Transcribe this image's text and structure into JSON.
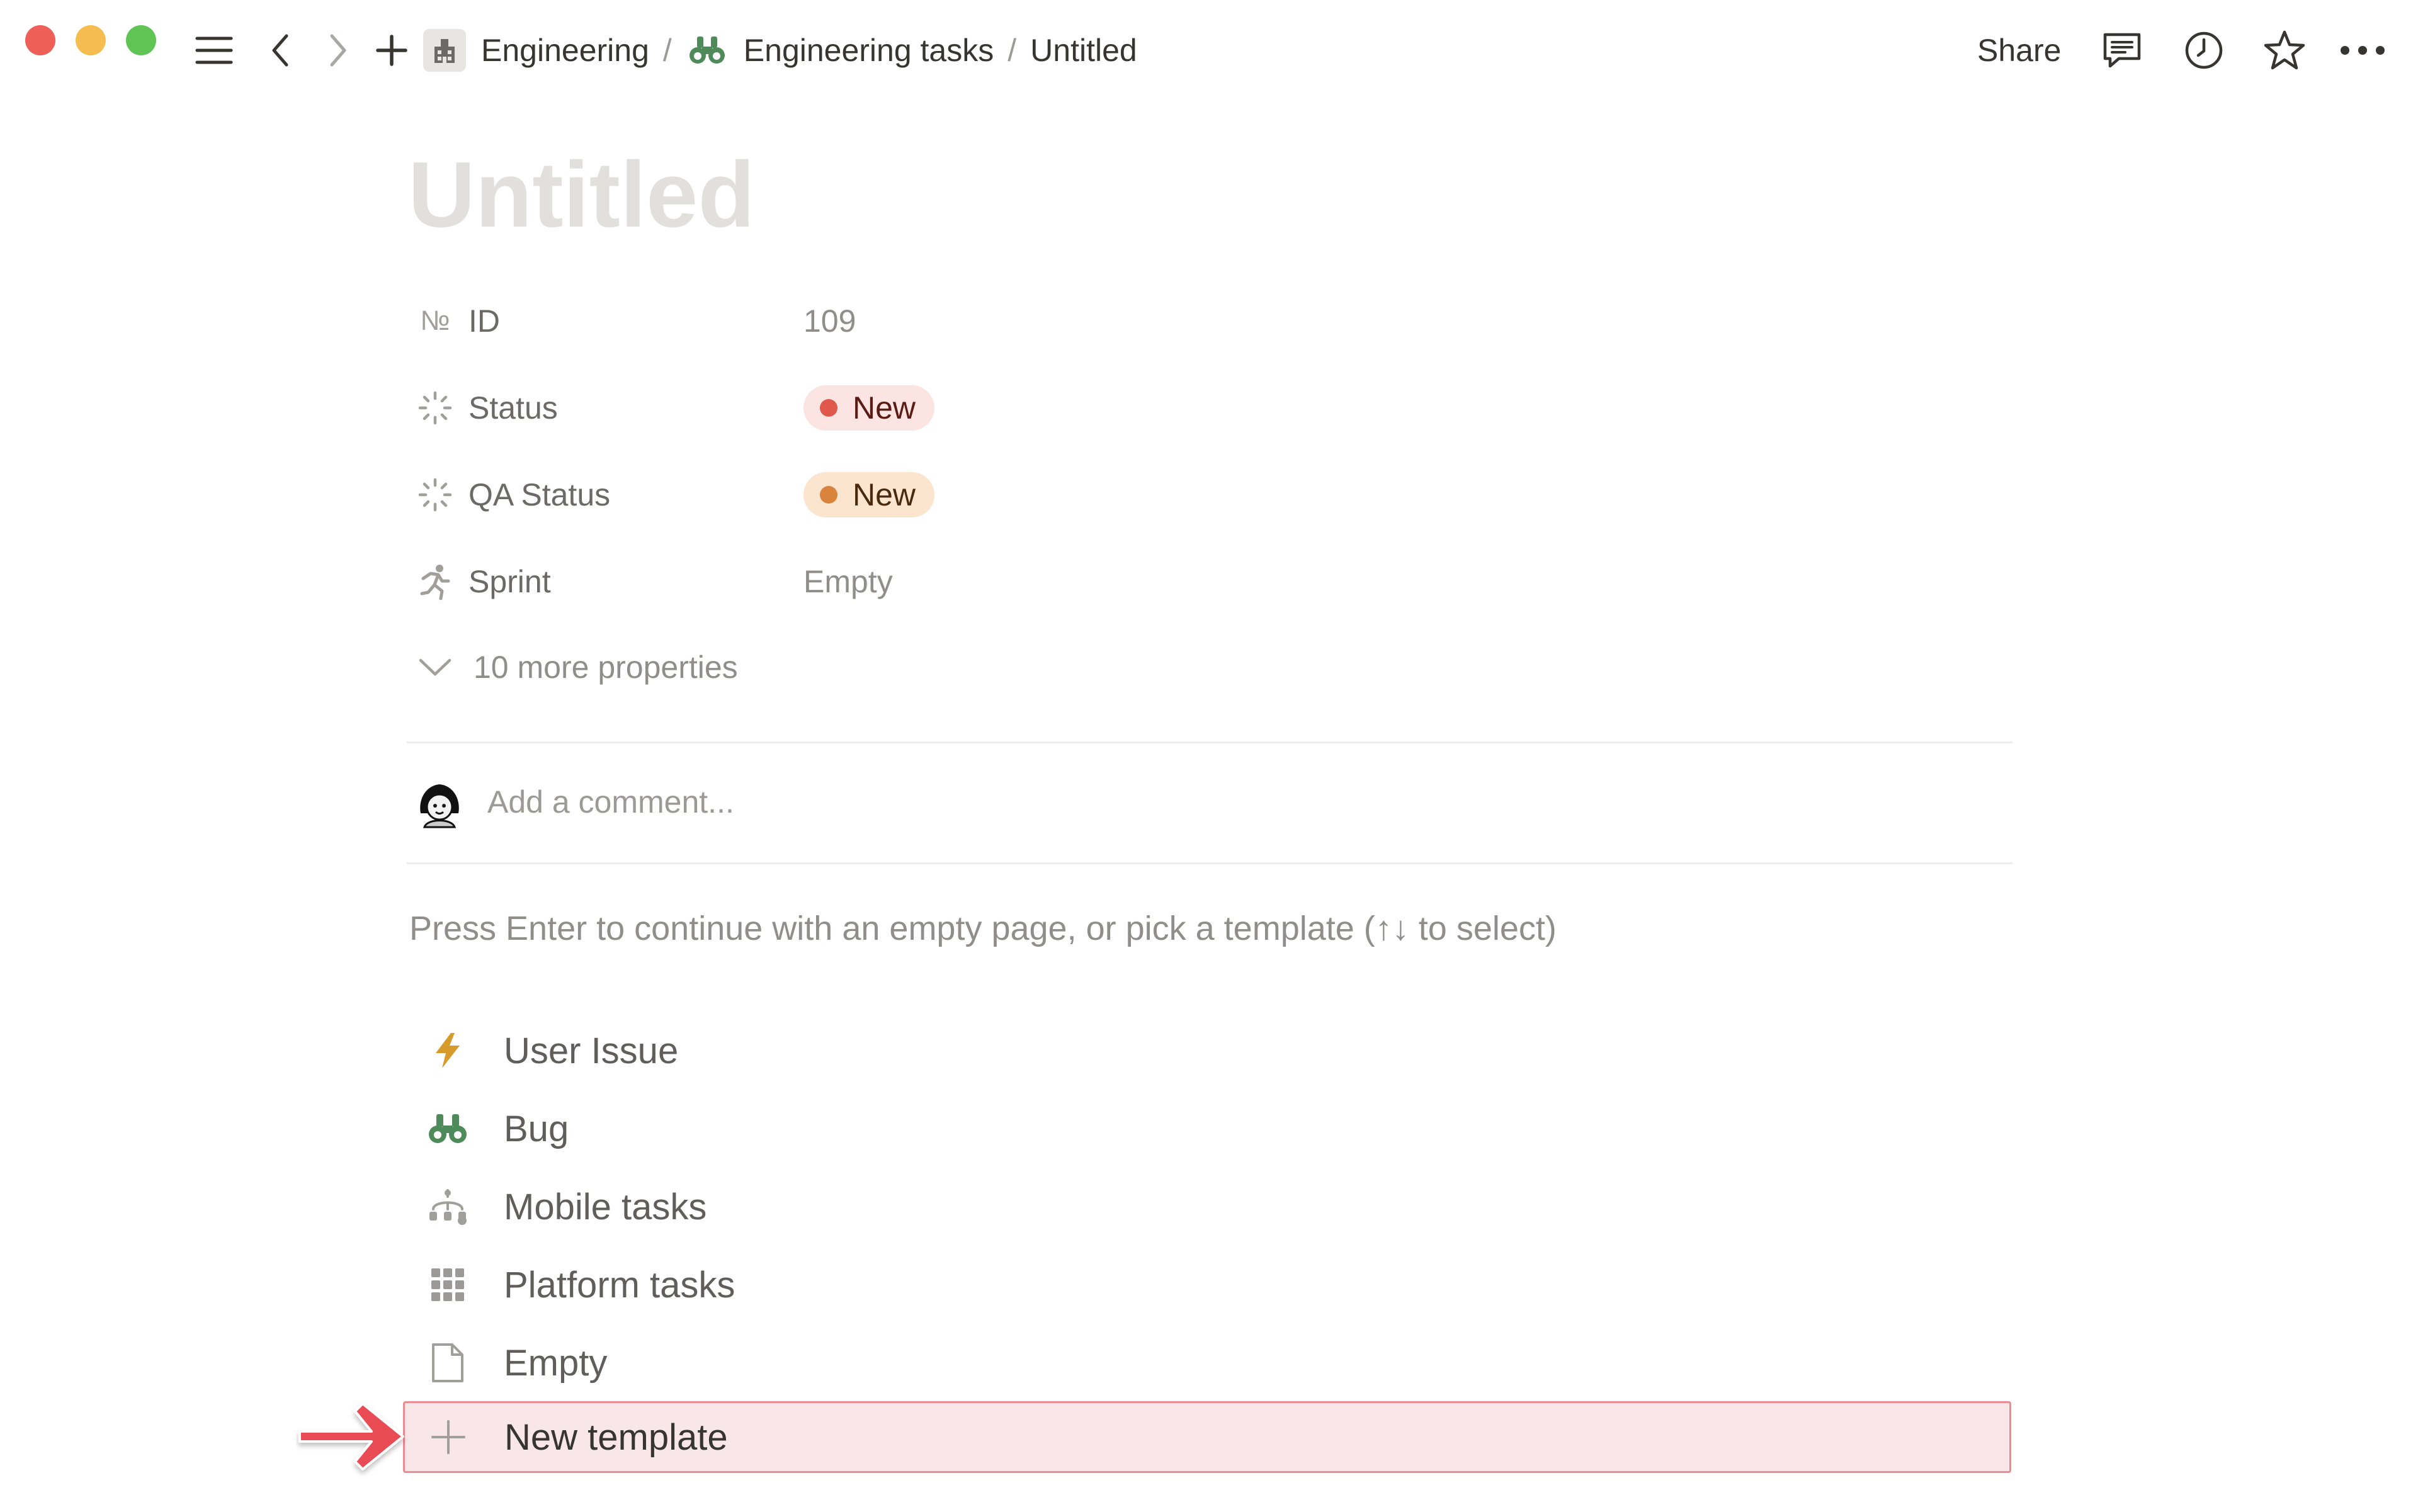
{
  "window": {
    "controls": {
      "close_color": "#ee5f57",
      "minimize_color": "#f5bd4f",
      "maximize_color": "#5fc453"
    }
  },
  "topbar": {
    "breadcrumb": [
      {
        "label": "Engineering",
        "icon": "building-icon"
      },
      {
        "label": "Engineering tasks",
        "icon": "binoculars-icon"
      },
      {
        "label": "Untitled",
        "icon": ""
      }
    ],
    "share_label": "Share",
    "icons": [
      "sidebar-menu-icon",
      "back-arrow-icon",
      "forward-arrow-icon",
      "plus-icon",
      "comment-icon",
      "history-clock-icon",
      "star-icon",
      "more-dots-icon"
    ]
  },
  "page": {
    "title_placeholder": "Untitled",
    "properties": [
      {
        "icon": "number-icon",
        "icon_text": "№",
        "label": "ID",
        "value": "109",
        "type": "text"
      },
      {
        "icon": "status-icon",
        "icon_text": "",
        "label": "Status",
        "value": "New",
        "type": "pill",
        "pill_color": "#e0584c"
      },
      {
        "icon": "status-icon",
        "icon_text": "",
        "label": "QA Status",
        "value": "New",
        "type": "pill",
        "pill_color": "#d9843c"
      },
      {
        "icon": "runner-icon",
        "icon_text": "",
        "label": "Sprint",
        "value": "Empty",
        "type": "text"
      }
    ],
    "more_properties_label": "10 more properties",
    "comment_placeholder": "Add a comment...",
    "template_hint": "Press Enter to continue with an empty page, or pick a template (↑↓ to select)",
    "templates": [
      {
        "label": "User Issue",
        "icon": "lightning-icon",
        "color": "#d79b2b"
      },
      {
        "label": "Bug",
        "icon": "binoculars-icon",
        "color": "#4e8a5a"
      },
      {
        "label": "Mobile tasks",
        "icon": "hierarchy-icon",
        "color": "#a19f9a"
      },
      {
        "label": "Platform tasks",
        "icon": "grid-icon",
        "color": "#9b9a97"
      },
      {
        "label": "Empty",
        "icon": "document-icon",
        "color": "#a19f9a"
      },
      {
        "label": "New template",
        "icon": "plus-icon",
        "color": "#a19f9a"
      }
    ],
    "highlight_color": "#e94b55"
  }
}
